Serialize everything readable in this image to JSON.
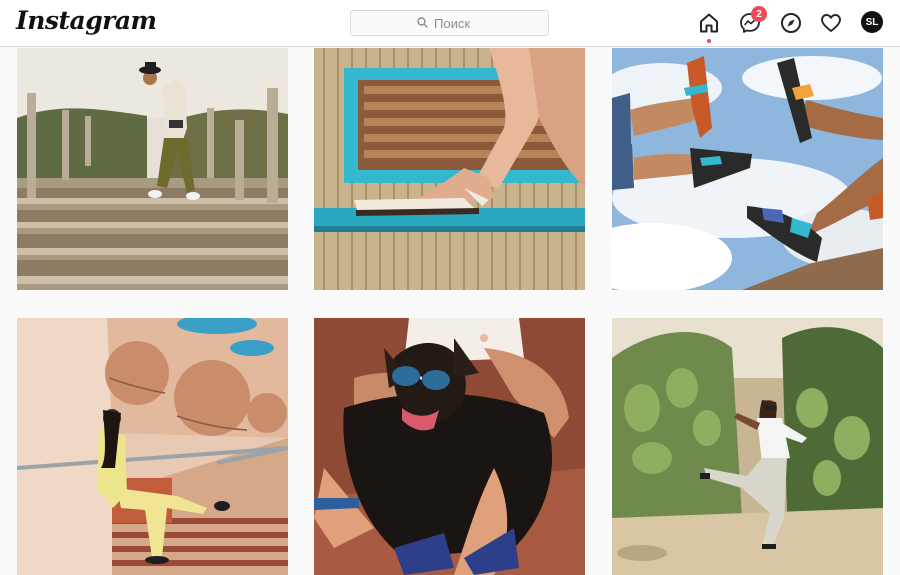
{
  "header": {
    "logo_text": "Instagram",
    "search": {
      "placeholder": "Поиск",
      "icon": "search-icon"
    },
    "nav": {
      "home_icon": "home-icon",
      "messenger_icon": "messenger-icon",
      "messenger_badge": "2",
      "explore_icon": "compass-icon",
      "activity_icon": "heart-icon",
      "profile_initials": "SL"
    }
  },
  "feed": {
    "posts": [
      {
        "subject": "person-climbing-wooden-stairs"
      },
      {
        "subject": "sandals-on-blue-bench"
      },
      {
        "subject": "feet-in-sandals-against-sky"
      },
      {
        "subject": "woman-on-stairs-yellow-outfit"
      },
      {
        "subject": "dog-with-sunglasses"
      },
      {
        "subject": "woman-among-cacti"
      }
    ]
  },
  "colors": {
    "badge": "#ed4956",
    "border": "#dbdbdb",
    "background": "#fafafa",
    "accent_turquoise": "#33b8cf"
  }
}
